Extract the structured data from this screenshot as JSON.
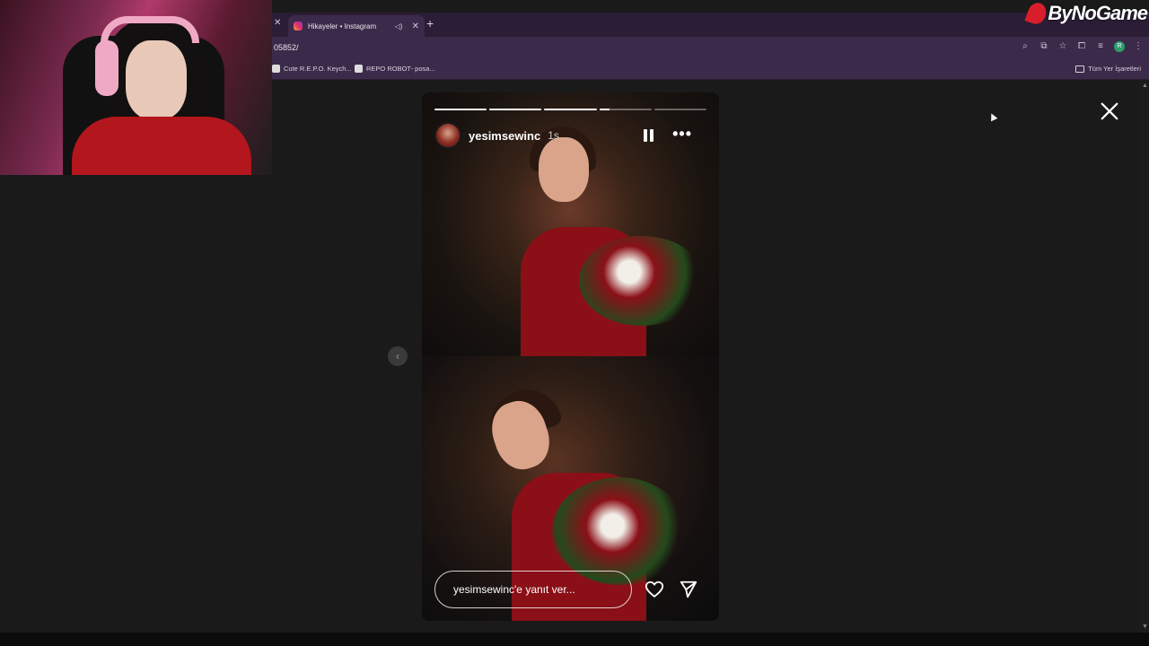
{
  "browser": {
    "tab_title": "Hikayeler • Instagram",
    "tab_audio_icon": "speaker-icon",
    "url_fragment": "05852/",
    "bookmarks": [
      {
        "label": "Cute R.E.P.O. Keych..."
      },
      {
        "label": "REPO ROBOT- posa..."
      }
    ],
    "bookmarks_all_label": "Tüm Yer İşaretleri",
    "profile_initial": "R"
  },
  "overlay": {
    "logo_text": "ByNoGame"
  },
  "story": {
    "username": "yesimsewinc",
    "time_ago": "1s",
    "reply_placeholder": "yesimsewinc'e yanıt ver...",
    "segments_progress": [
      1,
      1,
      1,
      0.2,
      0
    ]
  }
}
